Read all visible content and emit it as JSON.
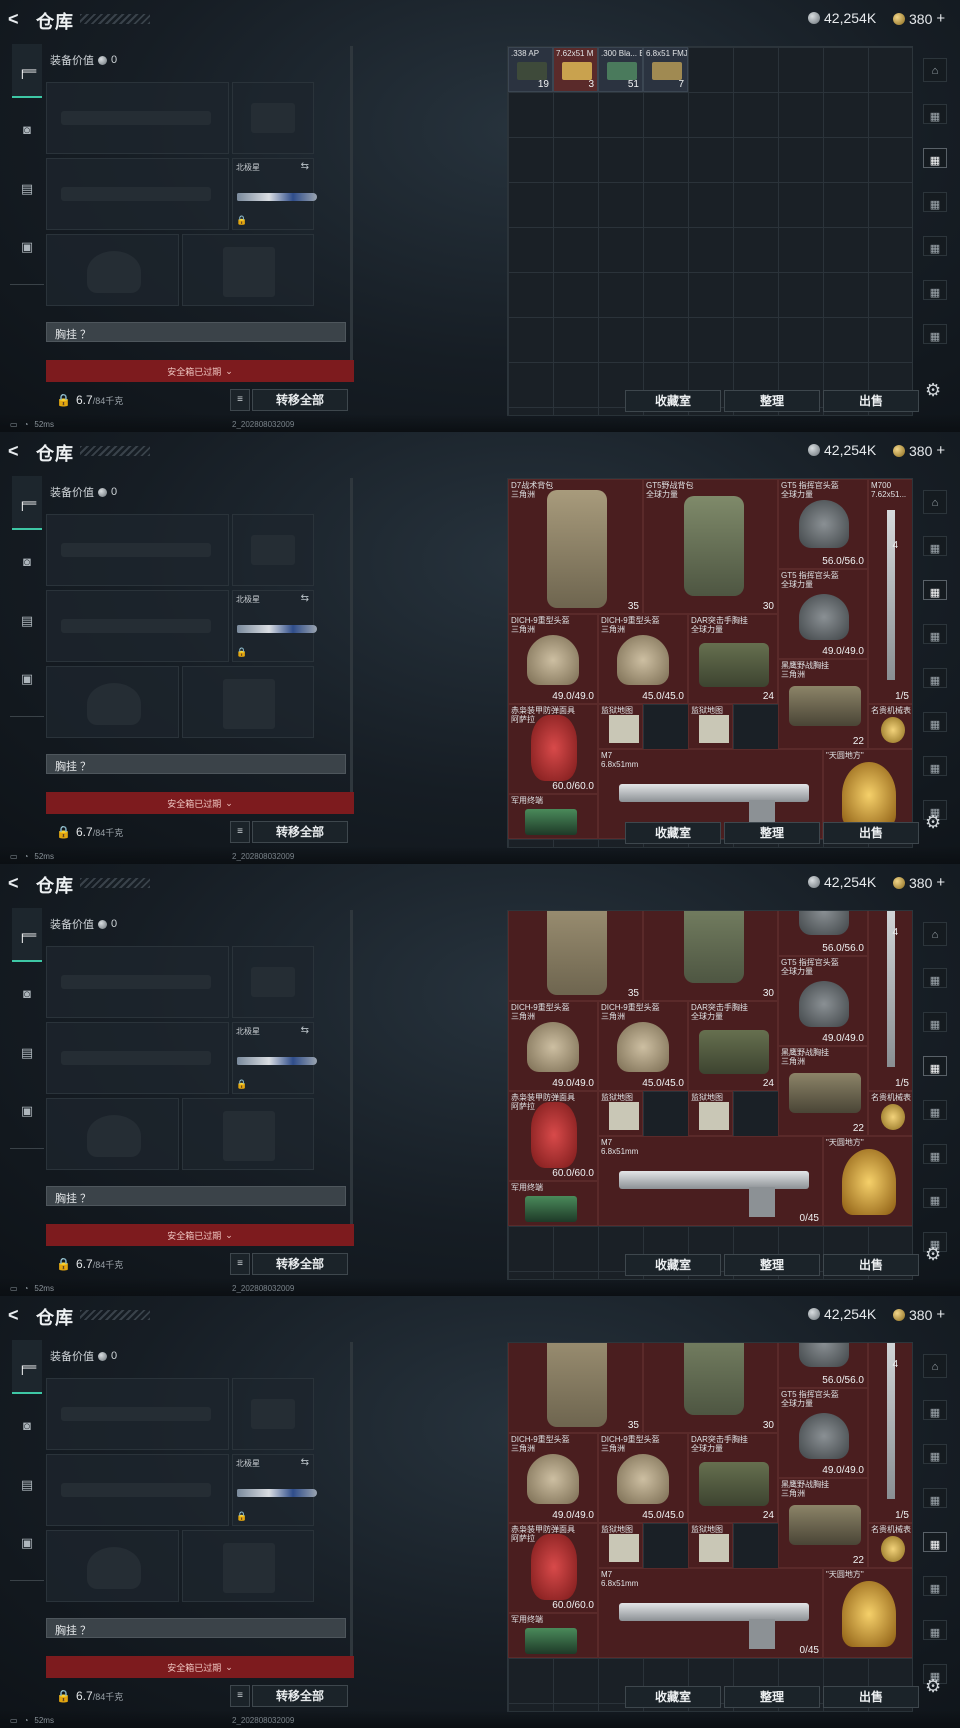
{
  "header": {
    "back": "<",
    "title": "仓库",
    "silver": "42,254K",
    "gold": "380",
    "gold_plus": "+"
  },
  "sidebar": {
    "weapon_icon": "pistol-icon",
    "items": [
      "helmet-icon",
      "vest-icon",
      "case-icon"
    ]
  },
  "equip": {
    "value_label": "装备价值",
    "value": "0",
    "knife_label": "北极星",
    "chest_label": "胸挂 ？",
    "safe_box": "安全箱已过期",
    "weight": "6.7",
    "weight_max": "/84千克",
    "transfer_all": "转移全部",
    "list_icon": "≡"
  },
  "buttons": {
    "collect": "收藏室",
    "sort": "整理",
    "sell": "出售"
  },
  "status": {
    "ping": "52ms",
    "build": "2_202808032009"
  },
  "frame1_items": [
    {
      "name": ".338 AP",
      "qty": "19"
    },
    {
      "name": "7.62x51 M",
      "qty": "3"
    },
    {
      "name": ".300 Bla... BCP FMJ",
      "qty": "51"
    },
    {
      "name": "6.8x51 FMJ",
      "qty": "7"
    }
  ],
  "items": {
    "d7": {
      "name": "D7战术背包",
      "sub": "三角洲",
      "qty": "35"
    },
    "gt5bag": {
      "name": "GT5野战背包",
      "sub": "全球力量",
      "qty": "30"
    },
    "gt5helm1": {
      "name": "GT5 指挥官头盔",
      "sub": "全球力量",
      "qty": "56.0/56.0"
    },
    "m700": {
      "name": "M700",
      "sub": "7.62x51...",
      "qty": "4"
    },
    "gt5helm2": {
      "name": "GT5 指挥官头盔",
      "sub": "全球力量",
      "qty": "49.0/49.0"
    },
    "dich1": {
      "name": "DICH-9重型头盔",
      "sub": "三角洲",
      "qty": "49.0/49.0"
    },
    "dich2": {
      "name": "DICH-9重型头盔",
      "sub": "三角洲",
      "qty": "45.0/45.0"
    },
    "dar": {
      "name": "DAR突击手胸挂",
      "sub": "全球力量",
      "qty": "24"
    },
    "heiying": {
      "name": "黑鹰野战胸挂",
      "sub": "三角洲",
      "qty": "22"
    },
    "m700qty": {
      "qty": "1/5"
    },
    "redmask": {
      "name": "赤枭装甲防弹面具",
      "sub": "阿萨拉",
      "qty": "60.0/60.0"
    },
    "map1": {
      "name": "监狱地图"
    },
    "map2": {
      "name": "监狱地图"
    },
    "watch": {
      "name": "名贵机械表"
    },
    "m7": {
      "name": "M7",
      "sub": "6.8x51mm",
      "qty": "0/45"
    },
    "tianyuan": {
      "name": "\"天圆地方\""
    },
    "laptop": {
      "name": "军用终端"
    }
  }
}
